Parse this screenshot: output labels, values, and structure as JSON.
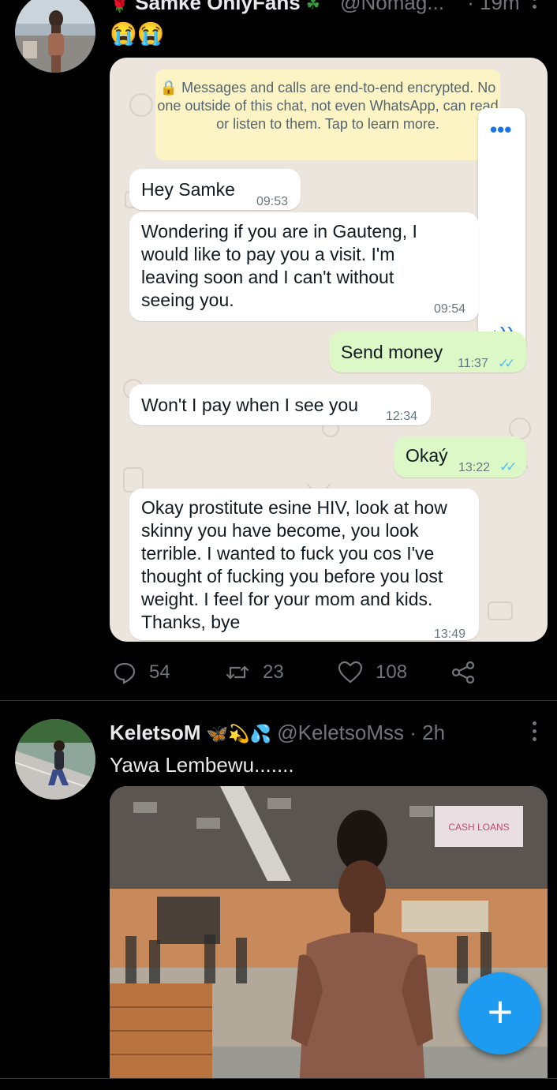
{
  "tweet1": {
    "display_name": "Samke OnlyFans",
    "name_emoji_left": "🌹",
    "name_emoji_right": "☘",
    "handle": "@Nomag...",
    "time": "· 19m",
    "text": "😭😭",
    "chat": {
      "encryption_notice": "🔒 Messages and calls are end-to-end encrypted. No one outside of this chat, not even WhatsApp, can read or listen to them. Tap to learn more.",
      "messages": [
        {
          "dir": "in",
          "text": "Hey Samke",
          "time": "09:53"
        },
        {
          "dir": "in",
          "text": "Wondering if you are in Gauteng, I would like to pay you a visit. I'm leaving soon and I can't without seeing you.",
          "time": "09:54"
        },
        {
          "dir": "out",
          "text": "Send money",
          "time": "11:37"
        },
        {
          "dir": "in",
          "text": "Won't I pay when I see you",
          "time": "12:34"
        },
        {
          "dir": "out",
          "text": "Okaý",
          "time": "13:22"
        },
        {
          "dir": "in",
          "text": "Okay prostitute esine HIV, look at how skinny you have become, you look terrible. I wanted to fuck you cos I've thought of fucking you before you lost weight. I feel for your mom and kids. Thanks, bye",
          "time": "13:49"
        }
      ],
      "read_ticks": "✓✓",
      "overlay_dots": "•••",
      "overlay_icon": "♪))"
    },
    "stats": {
      "replies": "54",
      "retweets": "23",
      "likes": "108"
    }
  },
  "tweet2": {
    "display_name": "KeletsoM",
    "name_emojis": "🦋💫💦",
    "handle": "@KeletsoMss",
    "time": "· 2h",
    "text": "Yawa Lembewu.......",
    "photo_sign_text": "CASH LOANS"
  },
  "fab": {
    "label": "+"
  },
  "colors": {
    "background": "#000000",
    "accent": "#1d9bf0",
    "whatsapp_out_bubble": "#dcf8c6",
    "whatsapp_in_bubble": "#ffffff",
    "whatsapp_notice": "#fdf4c5"
  }
}
